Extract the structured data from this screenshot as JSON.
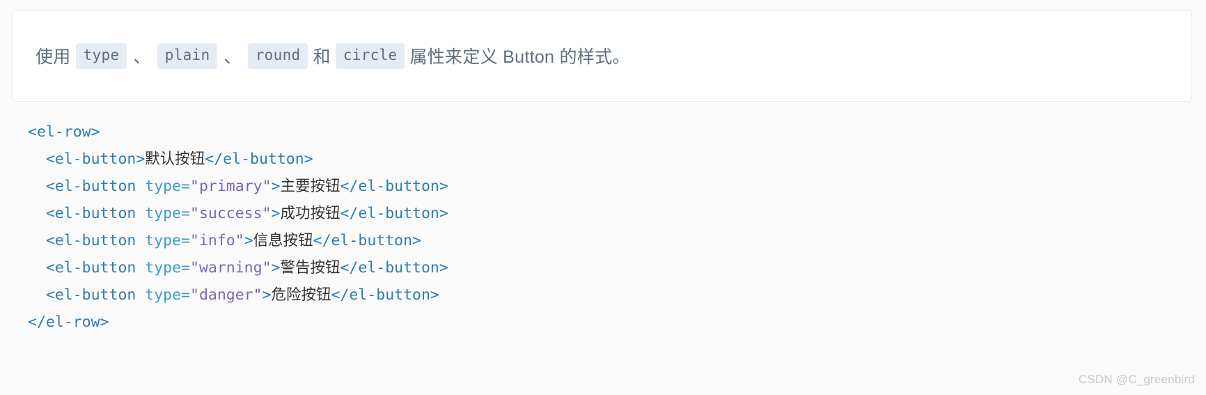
{
  "page": {
    "background_color": "#fafafa"
  },
  "description": {
    "prefix": "使用",
    "chips": [
      "type",
      "plain",
      "round",
      "circle"
    ],
    "separator_1": "、",
    "separator_2": "、",
    "conjunction": "和",
    "suffix": "属性来定义 Button 的样式。",
    "text_color": "#5e6d82",
    "chip_background": "#e6ebf5"
  },
  "code": {
    "language": "html",
    "colors": {
      "tag": "#2e7bb8",
      "attribute": "#3f9bc4",
      "string": "#7d65b5",
      "text": "#333333"
    },
    "lines": [
      {
        "indent": "",
        "tokens": [
          {
            "type": "tag",
            "text": "<el-row>"
          }
        ]
      },
      {
        "indent": "  ",
        "tokens": [
          {
            "type": "tag",
            "text": "<el-button>"
          },
          {
            "type": "text",
            "text": "默认按钮"
          },
          {
            "type": "tag",
            "text": "</el-button>"
          }
        ]
      },
      {
        "indent": "  ",
        "tokens": [
          {
            "type": "tag",
            "text": "<el-button "
          },
          {
            "type": "attr",
            "text": "type="
          },
          {
            "type": "string",
            "text": "\"primary\""
          },
          {
            "type": "tag",
            "text": ">"
          },
          {
            "type": "text",
            "text": "主要按钮"
          },
          {
            "type": "tag",
            "text": "</el-button>"
          }
        ]
      },
      {
        "indent": "  ",
        "tokens": [
          {
            "type": "tag",
            "text": "<el-button "
          },
          {
            "type": "attr",
            "text": "type="
          },
          {
            "type": "string",
            "text": "\"success\""
          },
          {
            "type": "tag",
            "text": ">"
          },
          {
            "type": "text",
            "text": "成功按钮"
          },
          {
            "type": "tag",
            "text": "</el-button>"
          }
        ]
      },
      {
        "indent": "  ",
        "tokens": [
          {
            "type": "tag",
            "text": "<el-button "
          },
          {
            "type": "attr",
            "text": "type="
          },
          {
            "type": "string",
            "text": "\"info\""
          },
          {
            "type": "tag",
            "text": ">"
          },
          {
            "type": "text",
            "text": "信息按钮"
          },
          {
            "type": "tag",
            "text": "</el-button>"
          }
        ]
      },
      {
        "indent": "  ",
        "tokens": [
          {
            "type": "tag",
            "text": "<el-button "
          },
          {
            "type": "attr",
            "text": "type="
          },
          {
            "type": "string",
            "text": "\"warning\""
          },
          {
            "type": "tag",
            "text": ">"
          },
          {
            "type": "text",
            "text": "警告按钮"
          },
          {
            "type": "tag",
            "text": "</el-button>"
          }
        ]
      },
      {
        "indent": "  ",
        "tokens": [
          {
            "type": "tag",
            "text": "<el-button "
          },
          {
            "type": "attr",
            "text": "type="
          },
          {
            "type": "string",
            "text": "\"danger\""
          },
          {
            "type": "tag",
            "text": ">"
          },
          {
            "type": "text",
            "text": "危险按钮"
          },
          {
            "type": "tag",
            "text": "</el-button>"
          }
        ]
      },
      {
        "indent": "",
        "tokens": [
          {
            "type": "tag",
            "text": "</el-row>"
          }
        ]
      }
    ]
  },
  "watermark": {
    "text": "CSDN @C_greenbird",
    "color": "#c9c9c9"
  }
}
